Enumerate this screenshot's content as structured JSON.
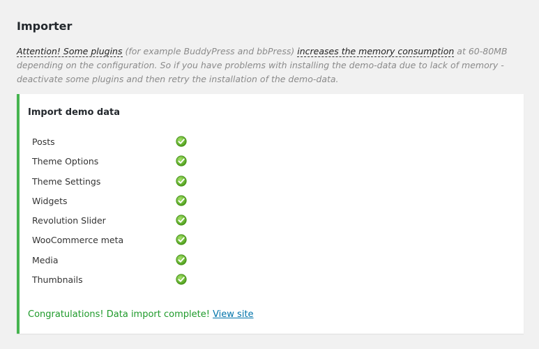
{
  "header": {
    "title": "Importer"
  },
  "notice": {
    "part1": "Attention! Some plugins",
    "part2": " (for example BuddyPress and bbPress) ",
    "part3": "increases the memory consumption",
    "part4": " at 60-80MB depending on the configuration. So if you have problems with installing the demo-data due to lack of memory - deactivate some plugins and then retry the installation of the demo-data."
  },
  "panel": {
    "title": "Import demo data",
    "items": [
      {
        "label": "Posts",
        "status": "check-icon"
      },
      {
        "label": "Theme Options",
        "status": "check-icon"
      },
      {
        "label": "Theme Settings",
        "status": "check-icon"
      },
      {
        "label": "Widgets",
        "status": "check-icon"
      },
      {
        "label": "Revolution Slider",
        "status": "check-icon"
      },
      {
        "label": "WooCommerce meta",
        "status": "check-icon"
      },
      {
        "label": "Media",
        "status": "check-icon"
      },
      {
        "label": "Thumbnails",
        "status": "check-icon"
      }
    ],
    "success_message": "Congratulations! Data import complete!",
    "view_site_label": "View site"
  },
  "colors": {
    "accent": "#46b450",
    "success_text": "#1e9a2a",
    "link": "#0073aa"
  }
}
